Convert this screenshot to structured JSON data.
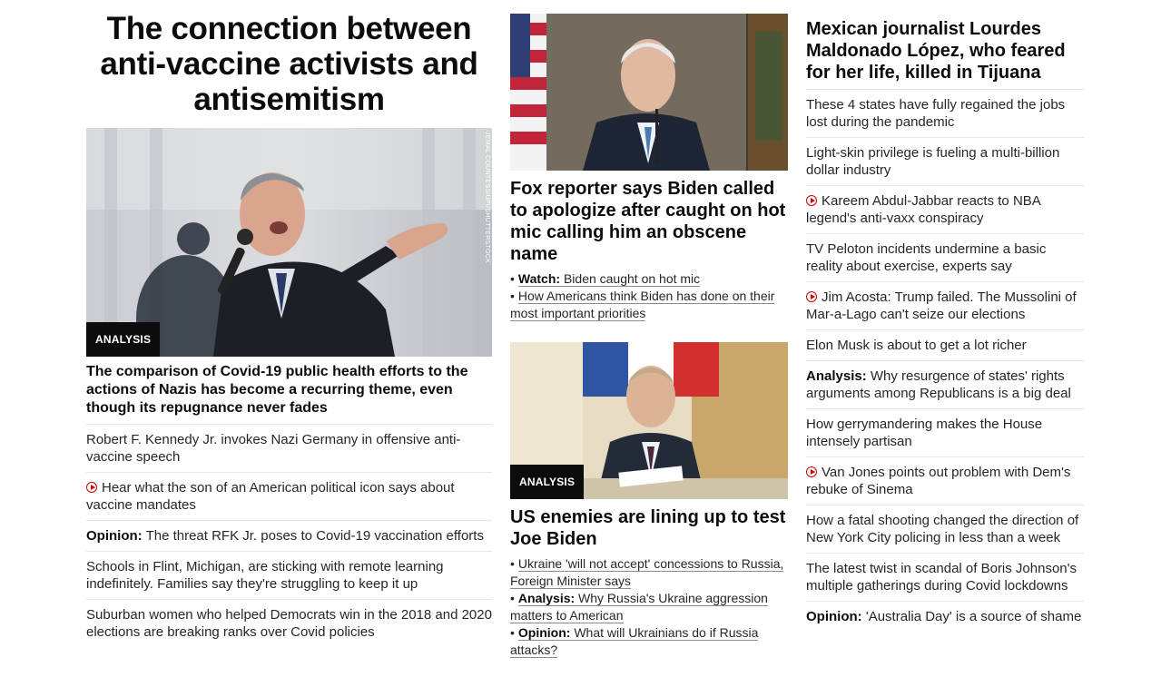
{
  "col1": {
    "hero_title": "The connection between anti-vaccine activists and antisemitism",
    "image_credit": "JEMAL COUNTESS/UPI/SHUTTERSTOCK",
    "badge": "ANALYSIS",
    "lead_headline": "The comparison of Covid-19 public health efforts to the actions of Nazis has become a recurring theme, even though its repugnance never fades",
    "items": [
      {
        "prefix": "",
        "video": false,
        "text": "Robert F. Kennedy Jr. invokes Nazi Germany in offensive anti-vaccine speech"
      },
      {
        "prefix": "",
        "video": true,
        "text": "Hear what the son of an American political icon says about vaccine mandates"
      },
      {
        "prefix": "Opinion:",
        "video": false,
        "text": "The threat RFK Jr. poses to Covid-19 vaccination efforts"
      },
      {
        "prefix": "",
        "video": false,
        "text": "Schools in Flint, Michigan, are sticking with remote learning indefinitely. Families say they're struggling to keep it up"
      },
      {
        "prefix": "",
        "video": false,
        "text": "Suburban women who helped Democrats win in the 2018 and 2020 elections are breaking ranks over Covid policies"
      }
    ]
  },
  "col2": {
    "story1": {
      "headline": "Fox reporter says Biden called to apologize after caught on hot mic calling him an obscene name",
      "links": [
        {
          "prefix": "Watch:",
          "text": "Biden caught on hot mic"
        },
        {
          "prefix": "",
          "text": "How Americans think Biden has done on their most important priorities"
        }
      ]
    },
    "story2": {
      "badge": "ANALYSIS",
      "headline": "US enemies are lining up to test Joe Biden",
      "links": [
        {
          "prefix": "",
          "text": "Ukraine 'will not accept' concessions to Russia, Foreign Minister says"
        },
        {
          "prefix": "Analysis:",
          "text": "Why Russia's Ukraine aggression matters to American"
        },
        {
          "prefix": "Opinion:",
          "text": "What will Ukrainians do if Russia attacks?"
        }
      ]
    },
    "bullet": "•"
  },
  "col3": {
    "headline": "Mexican journalist Lourdes Maldonado López, who feared for her life, killed in Tijuana",
    "items": [
      {
        "prefix": "",
        "video": false,
        "text": "These 4 states have fully regained the jobs lost during the pandemic"
      },
      {
        "prefix": "",
        "video": false,
        "text": "Light-skin privilege is fueling a multi-billion dollar industry"
      },
      {
        "prefix": "",
        "video": true,
        "text": "Kareem Abdul-Jabbar reacts to NBA legend's anti-vaxx conspiracy"
      },
      {
        "prefix": "",
        "video": false,
        "text": "TV Peloton incidents undermine a basic reality about exercise, experts say"
      },
      {
        "prefix": "",
        "video": true,
        "text": "Jim Acosta: Trump failed. The Mussolini of Mar-a-Lago can't seize our elections"
      },
      {
        "prefix": "",
        "video": false,
        "text": "Elon Musk is about to get a lot richer"
      },
      {
        "prefix": "Analysis:",
        "video": false,
        "text": "Why resurgence of states' rights arguments among Republicans is a big deal"
      },
      {
        "prefix": "",
        "video": false,
        "text": "How gerrymandering makes the House intensely partisan"
      },
      {
        "prefix": "",
        "video": true,
        "text": "Van Jones points out problem with Dem's rebuke of Sinema"
      },
      {
        "prefix": "",
        "video": false,
        "text": "How a fatal shooting changed the direction of New York City policing in less than a week"
      },
      {
        "prefix": "",
        "video": false,
        "text": "The latest twist in scandal of Boris Johnson's multiple gatherings during Covid lockdowns"
      },
      {
        "prefix": "Opinion:",
        "video": false,
        "text": "'Australia Day' is a source of shame"
      }
    ]
  },
  "colors": {
    "text": "#0c0c0c",
    "badge_bg": "#0c0c0c",
    "video_icon": "#cc0000",
    "divider": "#e6e6e6"
  }
}
